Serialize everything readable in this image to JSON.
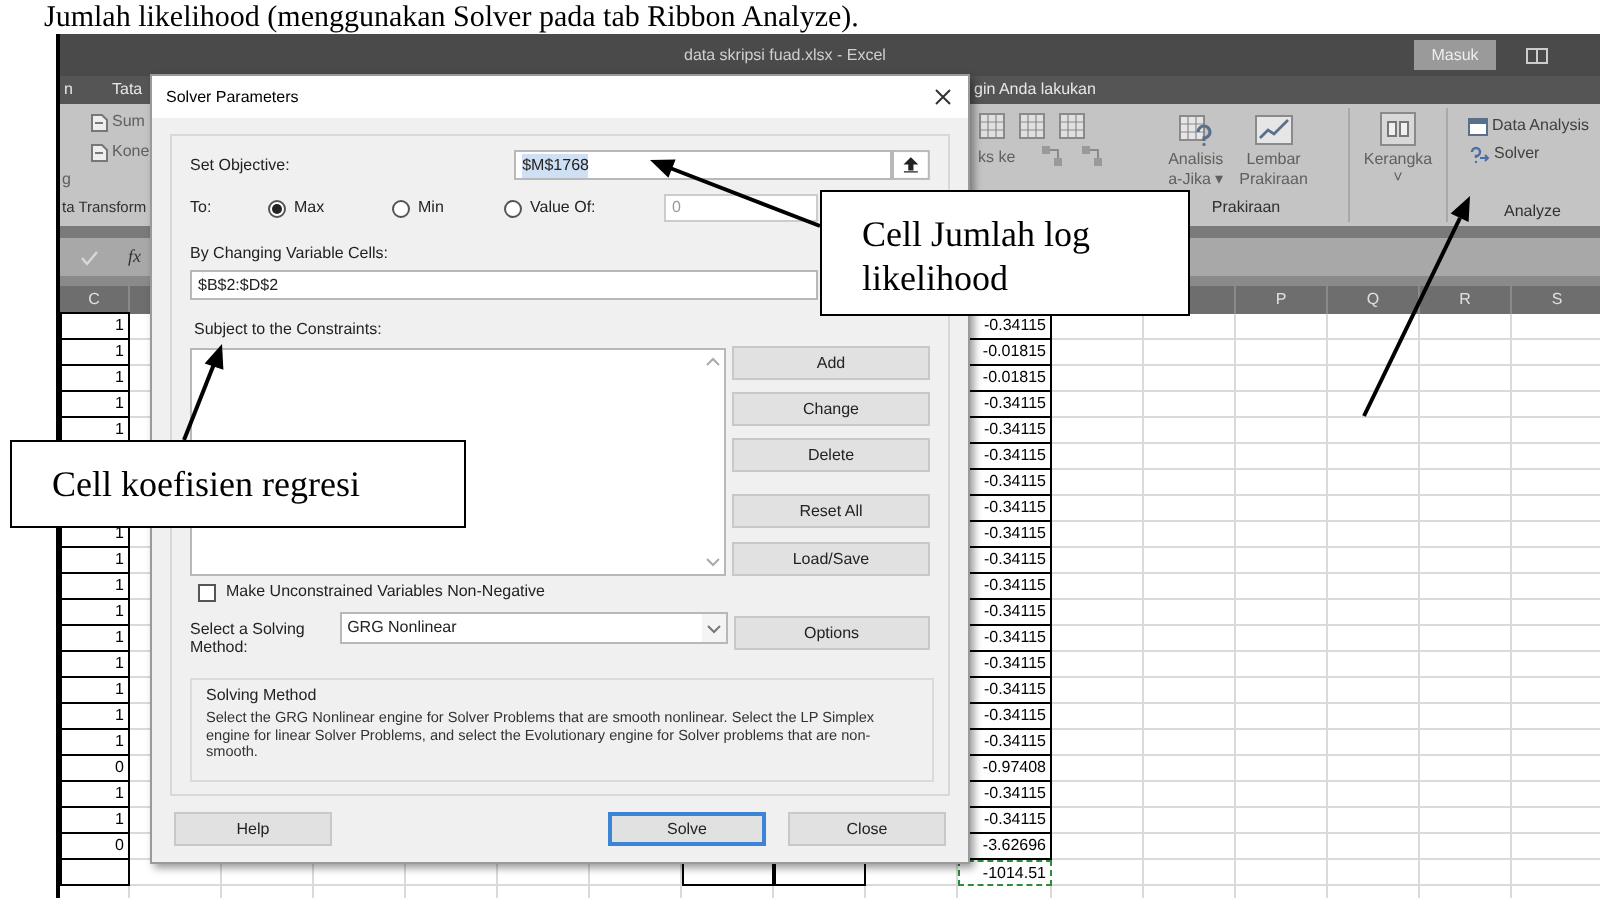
{
  "document_text": "Jumlah likelihood (menggunakan Solver pada tab Ribbon Analyze).",
  "excel": {
    "title": "data skripsi fuad.xlsx - Excel",
    "sign_in": "Masuk",
    "tabs_left": [
      "n",
      "Tata"
    ],
    "tell_me": "gin Anda lakukan",
    "ribbon_left": {
      "items": [
        "Sum",
        "Kone"
      ],
      "partial": "g",
      "group_label": "ta Transform"
    },
    "ribbon_right": {
      "partial_label": "ks ke",
      "forecast": {
        "items": [
          {
            "label": "Analisis",
            "sublabel": "a-Jika ▾"
          },
          {
            "label": "Lembar",
            "sublabel": "Prakiraan"
          }
        ],
        "group_label": "Prakiraan"
      },
      "outline": {
        "label": "Kerangka",
        "caret": "˅"
      },
      "analyze": {
        "items": [
          "Data Analysis",
          "Solver"
        ],
        "group_label": "Analyze"
      }
    },
    "formula_bar": {
      "fx": "fx"
    },
    "column_headers": [
      "C",
      "P",
      "Q",
      "R",
      "S"
    ],
    "rows": [
      {
        "c": "1",
        "value": "-0.34115"
      },
      {
        "c": "1",
        "value": "-0.01815"
      },
      {
        "c": "1",
        "value": "-0.01815"
      },
      {
        "c": "1",
        "value": "-0.34115"
      },
      {
        "c": "1",
        "value": "-0.34115"
      },
      {
        "value": "-0.34115"
      },
      {
        "value": "-0.34115"
      },
      {
        "value": "-0.34115"
      },
      {
        "c": "1",
        "value": "-0.34115"
      },
      {
        "c": "1",
        "value": "-0.34115"
      },
      {
        "c": "1",
        "value": "-0.34115"
      },
      {
        "c": "1",
        "value": "-0.34115"
      },
      {
        "c": "1",
        "value": "-0.34115"
      },
      {
        "c": "1",
        "value": "-0.34115"
      },
      {
        "c": "1",
        "value": "-0.34115"
      },
      {
        "c": "1",
        "value": "-0.34115"
      },
      {
        "c": "1",
        "value": "-0.34115"
      },
      {
        "c": "0",
        "value": "-0.97408"
      },
      {
        "c": "1",
        "value": "-0.34115"
      },
      {
        "c": "1",
        "value": "-0.34115"
      },
      {
        "c": "0",
        "value": "-3.62696"
      },
      {
        "value": "-1014.51",
        "selected": true
      }
    ]
  },
  "dialog": {
    "title": "Solver Parameters",
    "objective": {
      "label": "Set Objective:",
      "value": "$M$1768",
      "text_selected": true
    },
    "to": {
      "label": "To:",
      "options": [
        {
          "label": "Max",
          "selected": true
        },
        {
          "label": "Min",
          "selected": false
        },
        {
          "label": "Value Of:",
          "selected": false
        }
      ],
      "value_field": "0"
    },
    "changing_cells": {
      "label": "By Changing Variable Cells:",
      "value": "$B$2:$D$2"
    },
    "constraints": {
      "label": "Subject to the Constraints:",
      "buttons": [
        "Add",
        "Change",
        "Delete",
        "Reset All",
        "Load/Save"
      ]
    },
    "non_negative": {
      "label": "Make Unconstrained Variables Non-Negative",
      "checked": false
    },
    "method": {
      "label": "Select a Solving Method:",
      "value": "GRG Nonlinear",
      "options_button": "Options"
    },
    "description": {
      "title": "Solving Method",
      "text": "Select the GRG Nonlinear engine for Solver Problems that are smooth nonlinear. Select the LP Simplex engine for linear Solver Problems, and select the Evolutionary engine for Solver problems that are non-smooth."
    },
    "buttons": [
      {
        "label": "Help",
        "focused": false
      },
      {
        "label": "Solve",
        "focused": true
      },
      {
        "label": "Close",
        "focused": false
      }
    ]
  },
  "callouts": [
    {
      "text": "Cell Jumlah log likelihood"
    },
    {
      "text": "Cell koefisien regresi"
    }
  ]
}
